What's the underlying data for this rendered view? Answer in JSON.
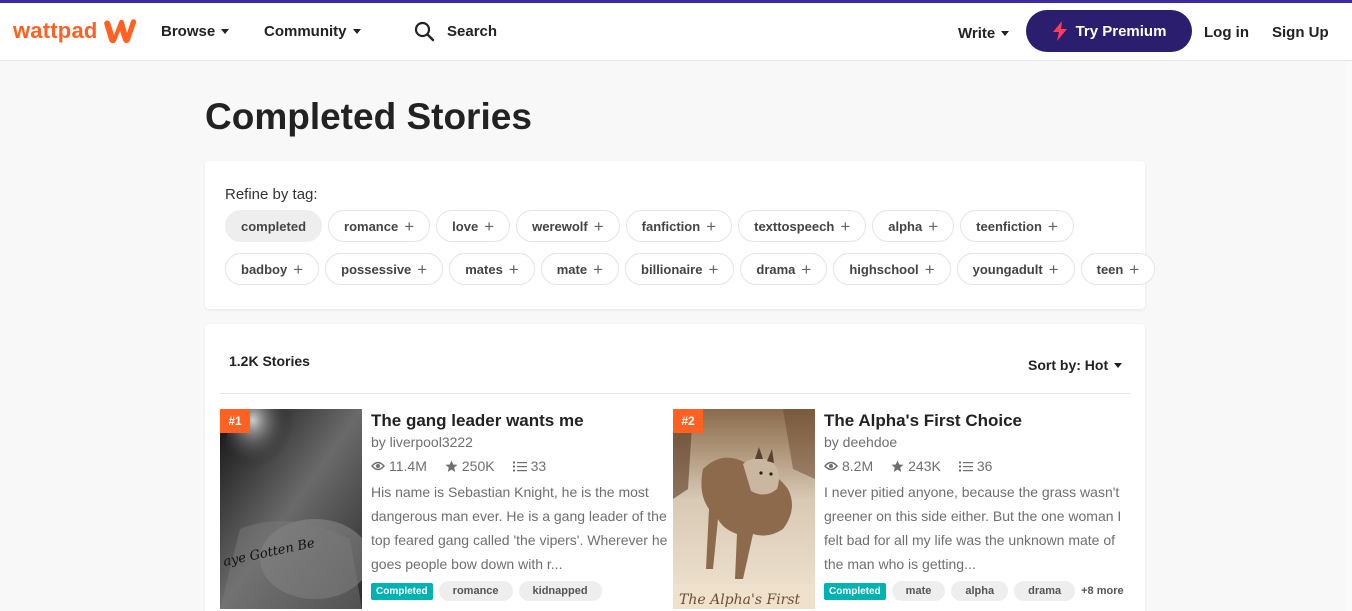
{
  "header": {
    "logo_text": "wattpad",
    "nav": {
      "browse": "Browse",
      "community": "Community"
    },
    "search_label": "Search",
    "write": "Write",
    "premium": "Try Premium",
    "login": "Log in",
    "signup": "Sign Up",
    "colors": {
      "brand": "#ff6122",
      "premium_bg": "#2b1e6f",
      "premium_icon": "#ff3b5c"
    }
  },
  "page_title": "Completed Stories",
  "refine": {
    "label": "Refine by tag:",
    "row1": [
      "completed",
      "romance",
      "love",
      "werewolf",
      "fanfiction",
      "texttospeech",
      "alpha",
      "teenfiction"
    ],
    "row2": [
      "badboy",
      "possessive",
      "mates",
      "mate",
      "billionaire",
      "drama",
      "highschool",
      "youngadult",
      "teen"
    ],
    "active": "completed",
    "plus": "+"
  },
  "results": {
    "count": "1.2K Stories",
    "sort": "Sort by: Hot"
  },
  "stories": [
    {
      "rank": "#1",
      "title": "The gang leader wants me",
      "author": "by liverpool3222",
      "reads": "11.4M",
      "votes": "250K",
      "parts": "33",
      "description": "His name is Sebastian Knight, he is the most dangerous man ever. He is a gang leader of the top feared gang called 'the vipers'. Wherever he goes people bow down with r...",
      "completed_label": "Completed",
      "tags": [
        "romance",
        "kidnapped"
      ],
      "more": "",
      "cover_text": "aye Gotten Be"
    },
    {
      "rank": "#2",
      "title": "The Alpha's First Choice",
      "author": "by deehdoe",
      "reads": "8.2M",
      "votes": "243K",
      "parts": "36",
      "description": "I never pitied anyone, because the grass wasn't greener on this side either. But the one woman I felt bad for all my life was the unknown mate of the man who is getting...",
      "completed_label": "Completed",
      "tags": [
        "mate",
        "alpha",
        "drama"
      ],
      "more": "+8 more",
      "cover_text": "The Alpha's First"
    }
  ]
}
